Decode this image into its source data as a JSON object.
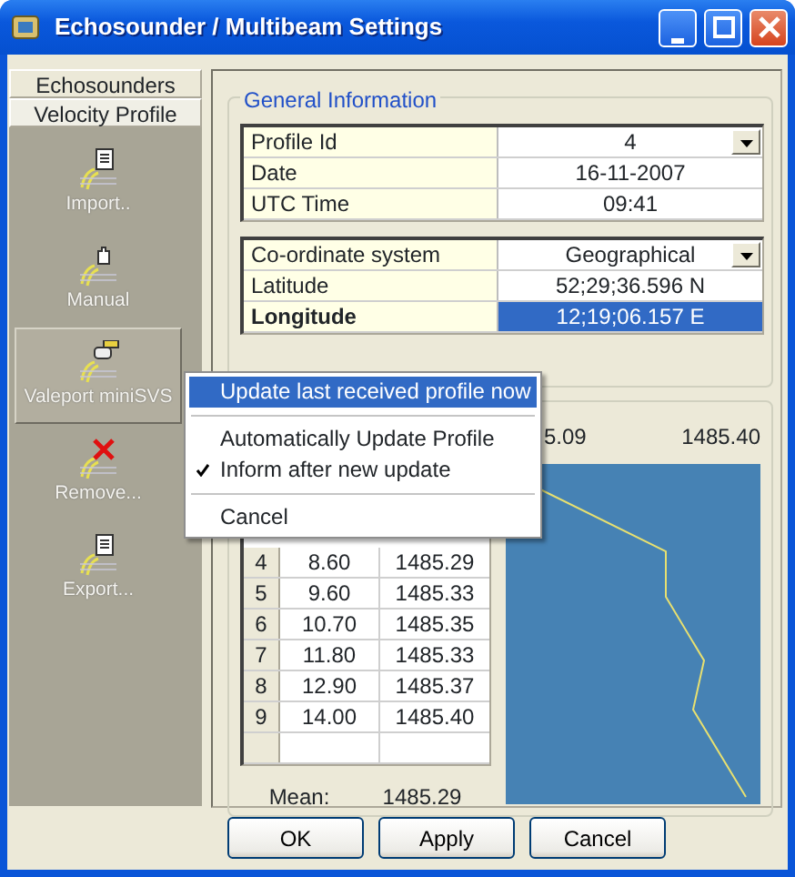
{
  "window": {
    "title": "Echosounder / Multibeam Settings"
  },
  "sidebar": {
    "tabs": [
      {
        "label": "Echosounders",
        "selected": false
      },
      {
        "label": "Velocity Profile",
        "selected": true
      }
    ],
    "items": [
      {
        "kind": "import",
        "label": "Import..",
        "selected": false
      },
      {
        "kind": "manual",
        "label": "Manual",
        "selected": false
      },
      {
        "kind": "device",
        "label": "Valeport miniSVS",
        "selected": true
      },
      {
        "kind": "remove",
        "label": "Remove...",
        "selected": false
      },
      {
        "kind": "export",
        "label": "Export...",
        "selected": false
      }
    ]
  },
  "general_information": {
    "title": "General Information",
    "profile_table": [
      {
        "label": "Profile Id",
        "value": "4",
        "kind": "dropdown",
        "selected": false
      },
      {
        "label": "Date",
        "value": "16-11-2007",
        "kind": "text",
        "selected": false
      },
      {
        "label": "UTC Time",
        "value": "09:41",
        "kind": "text",
        "selected": false
      }
    ],
    "position_table": [
      {
        "label": "Co-ordinate system",
        "value": "Geographical",
        "kind": "dropdown",
        "selected": false
      },
      {
        "label": "Latitude",
        "value": "52;29;36.596 N",
        "kind": "text",
        "selected": false
      },
      {
        "label": "Longitude",
        "value": "12;19;06.157 E",
        "kind": "text",
        "selected": true
      }
    ]
  },
  "profile": {
    "plot_labels": [
      "5.09",
      "1485.40"
    ],
    "rows": [
      {
        "index": "4",
        "column_2": "8.60",
        "column_3": "1485.29"
      },
      {
        "index": "5",
        "column_2": "9.60",
        "column_3": "1485.33"
      },
      {
        "index": "6",
        "column_2": "10.70",
        "column_3": "1485.35"
      },
      {
        "index": "7",
        "column_2": "11.80",
        "column_3": "1485.33"
      },
      {
        "index": "8",
        "column_2": "12.90",
        "column_3": "1485.37"
      },
      {
        "index": "9",
        "column_2": "14.00",
        "column_3": "1485.40"
      }
    ],
    "mean_label": "Mean:",
    "mean_value": "1485.29"
  },
  "context_menu": [
    {
      "kind": "item",
      "label": "Update last received profile now",
      "selected": true,
      "checked": false
    },
    {
      "kind": "separator"
    },
    {
      "kind": "item",
      "label": "Automatically Update Profile",
      "selected": false,
      "checked": false
    },
    {
      "kind": "item",
      "label": "Inform after new update",
      "selected": false,
      "checked": true
    },
    {
      "kind": "separator"
    },
    {
      "kind": "item",
      "label": "Cancel",
      "selected": false,
      "checked": false
    }
  ],
  "buttons": [
    "OK",
    "Apply",
    "Cancel"
  ]
}
